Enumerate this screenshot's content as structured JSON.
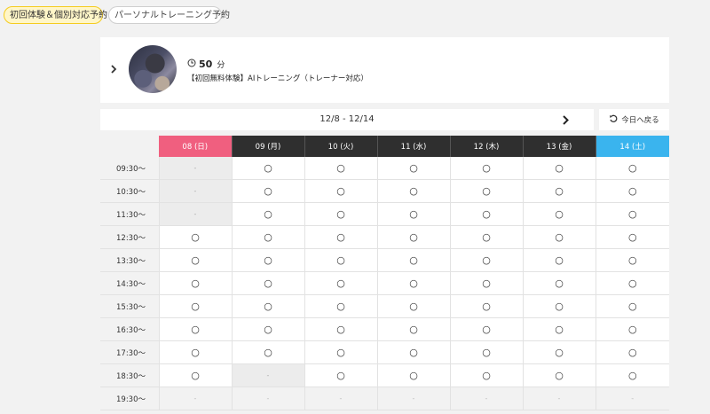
{
  "tabs": [
    {
      "label": "初回体験＆個別対応予約",
      "active": true
    },
    {
      "label": "パーソナルトレーニング予約",
      "active": false
    }
  ],
  "course": {
    "duration_value": "50",
    "duration_unit": "分",
    "title": "【初回無料体験】AIトレーニング（トレーナー対応）"
  },
  "week": {
    "range": "12/8 - 12/14",
    "today_label": "今日へ戻る"
  },
  "colors": {
    "sunday": "#f05f7f",
    "saturday": "#3ab4ee",
    "weekday": "#2f2f2f",
    "accent_tab": "#f5cc1f"
  },
  "days": [
    {
      "label": "08 (日)",
      "type": "sun"
    },
    {
      "label": "09 (月)",
      "type": "wk"
    },
    {
      "label": "10 (火)",
      "type": "wk"
    },
    {
      "label": "11 (水)",
      "type": "wk"
    },
    {
      "label": "12 (木)",
      "type": "wk"
    },
    {
      "label": "13 (金)",
      "type": "wk"
    },
    {
      "label": "14 (土)",
      "type": "sat"
    }
  ],
  "rows": [
    {
      "time": "09:30〜",
      "slots": [
        "-",
        "○",
        "○",
        "○",
        "○",
        "○",
        "○"
      ]
    },
    {
      "time": "10:30〜",
      "slots": [
        "-",
        "○",
        "○",
        "○",
        "○",
        "○",
        "○"
      ]
    },
    {
      "time": "11:30〜",
      "slots": [
        "-",
        "○",
        "○",
        "○",
        "○",
        "○",
        "○"
      ]
    },
    {
      "time": "12:30〜",
      "slots": [
        "○",
        "○",
        "○",
        "○",
        "○",
        "○",
        "○"
      ]
    },
    {
      "time": "13:30〜",
      "slots": [
        "○",
        "○",
        "○",
        "○",
        "○",
        "○",
        "○"
      ]
    },
    {
      "time": "14:30〜",
      "slots": [
        "○",
        "○",
        "○",
        "○",
        "○",
        "○",
        "○"
      ]
    },
    {
      "time": "15:30〜",
      "slots": [
        "○",
        "○",
        "○",
        "○",
        "○",
        "○",
        "○"
      ]
    },
    {
      "time": "16:30〜",
      "slots": [
        "○",
        "○",
        "○",
        "○",
        "○",
        "○",
        "○"
      ]
    },
    {
      "time": "17:30〜",
      "slots": [
        "○",
        "○",
        "○",
        "○",
        "○",
        "○",
        "○"
      ]
    },
    {
      "time": "18:30〜",
      "slots": [
        "○",
        "-",
        "○",
        "○",
        "○",
        "○",
        "○"
      ]
    },
    {
      "time": "19:30〜",
      "slots": [
        "-",
        "-",
        "-",
        "-",
        "-",
        "-",
        "-"
      ]
    }
  ]
}
